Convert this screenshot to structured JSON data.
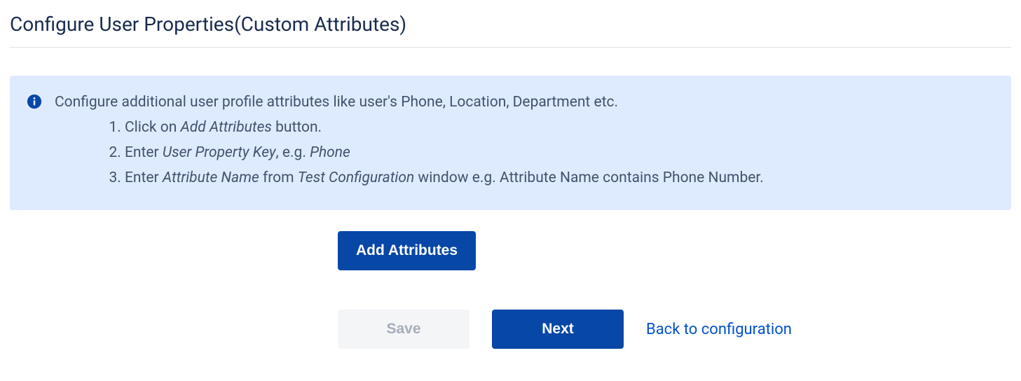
{
  "header": {
    "title": "Configure User Properties(Custom Attributes)"
  },
  "info": {
    "intro": "Configure additional user profile attributes like user's Phone, Location, Department etc.",
    "step1_prefix": "Click on ",
    "step1_italic": "Add Attributes",
    "step1_suffix": " button.",
    "step2_prefix": "Enter ",
    "step2_italic1": "User Property Key",
    "step2_mid": ", e.g. ",
    "step2_italic2": "Phone",
    "step3_prefix": "Enter ",
    "step3_italic1": "Attribute Name",
    "step3_mid": " from ",
    "step3_italic2": "Test Configuration",
    "step3_suffix": " window e.g. Attribute Name contains Phone Number."
  },
  "buttons": {
    "add_attributes": "Add Attributes",
    "save": "Save",
    "next": "Next",
    "back": "Back to configuration"
  }
}
